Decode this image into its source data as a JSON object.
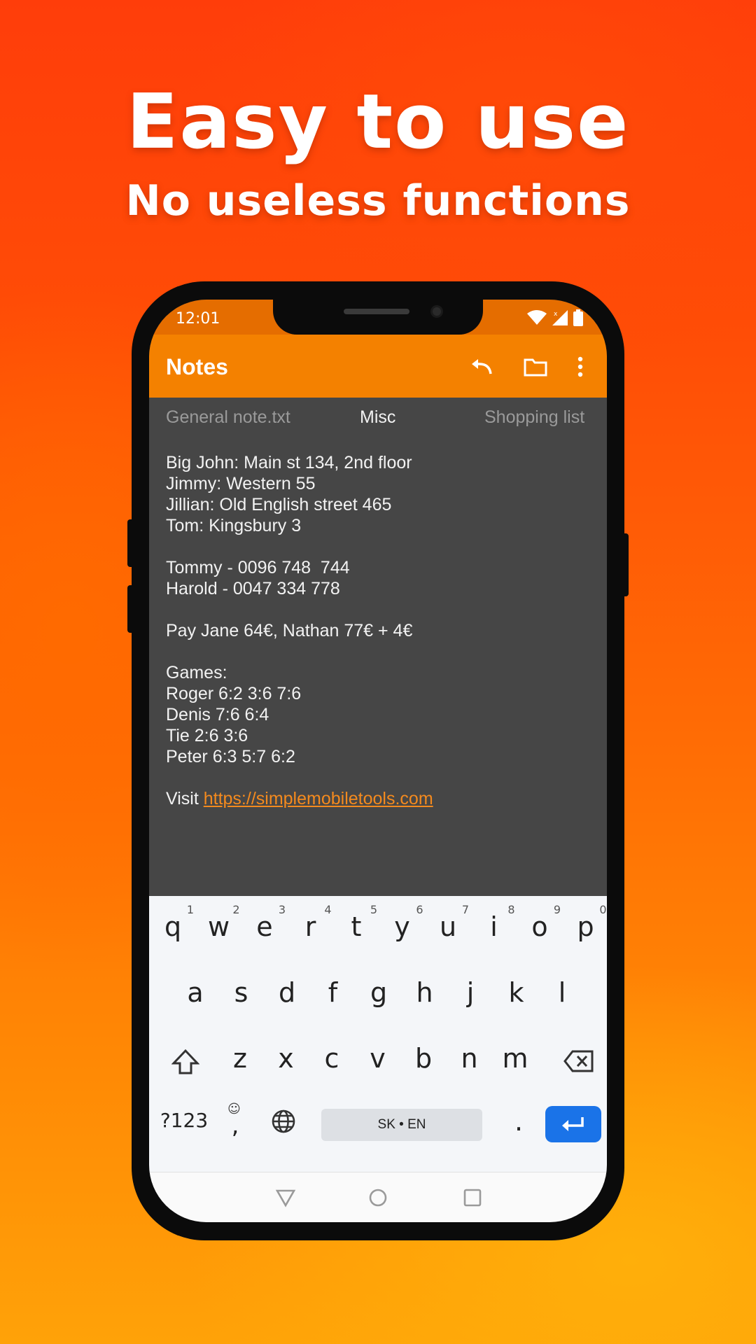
{
  "promo": {
    "title": "Easy to use",
    "subtitle": "No useless functions"
  },
  "status_bar": {
    "time": "12:01",
    "icons": [
      "wifi-icon",
      "signal-icon",
      "battery-icon"
    ]
  },
  "app_bar": {
    "title": "Notes",
    "actions": [
      "undo-icon",
      "folder-icon",
      "more-vert-icon"
    ],
    "color": "#f48100"
  },
  "tabs": [
    {
      "label": "General note.txt",
      "active": false
    },
    {
      "label": "Misc",
      "active": true
    },
    {
      "label": "Shopping list",
      "active": false
    }
  ],
  "note": {
    "lines": [
      "Big John: Main st 134, 2nd floor",
      "Jimmy: Western 55",
      "Jillian: Old English street 465",
      "Tom: Kingsbury 3",
      "",
      "Tommy - 0096 748  744",
      "Harold - 0047 334 778",
      "",
      "Pay Jane 64€, Nathan 77€ + 4€",
      "",
      "Games:",
      "Roger 6:2 3:6 7:6",
      "Denis 7:6 6:4",
      "Tie 2:6 3:6",
      "Peter 6:3 5:7 6:2",
      ""
    ],
    "link_prefix": "Visit ",
    "link_text": "https://simplemobiletools.com"
  },
  "keyboard": {
    "row1": [
      "q",
      "w",
      "e",
      "r",
      "t",
      "y",
      "u",
      "i",
      "o",
      "p"
    ],
    "row1_hints": [
      "1",
      "2",
      "3",
      "4",
      "5",
      "6",
      "7",
      "8",
      "9",
      "0"
    ],
    "row2": [
      "a",
      "s",
      "d",
      "f",
      "g",
      "h",
      "j",
      "k",
      "l"
    ],
    "row3": [
      "z",
      "x",
      "c",
      "v",
      "b",
      "n",
      "m"
    ],
    "symbols_key": "?123",
    "comma_key": ",",
    "emoji_hint": "☺",
    "period_key": ".",
    "space_label": "SK • EN",
    "enter_color": "#1a73e8"
  },
  "nav_bar": {
    "icons": [
      "back-icon",
      "home-icon",
      "recents-icon"
    ]
  }
}
